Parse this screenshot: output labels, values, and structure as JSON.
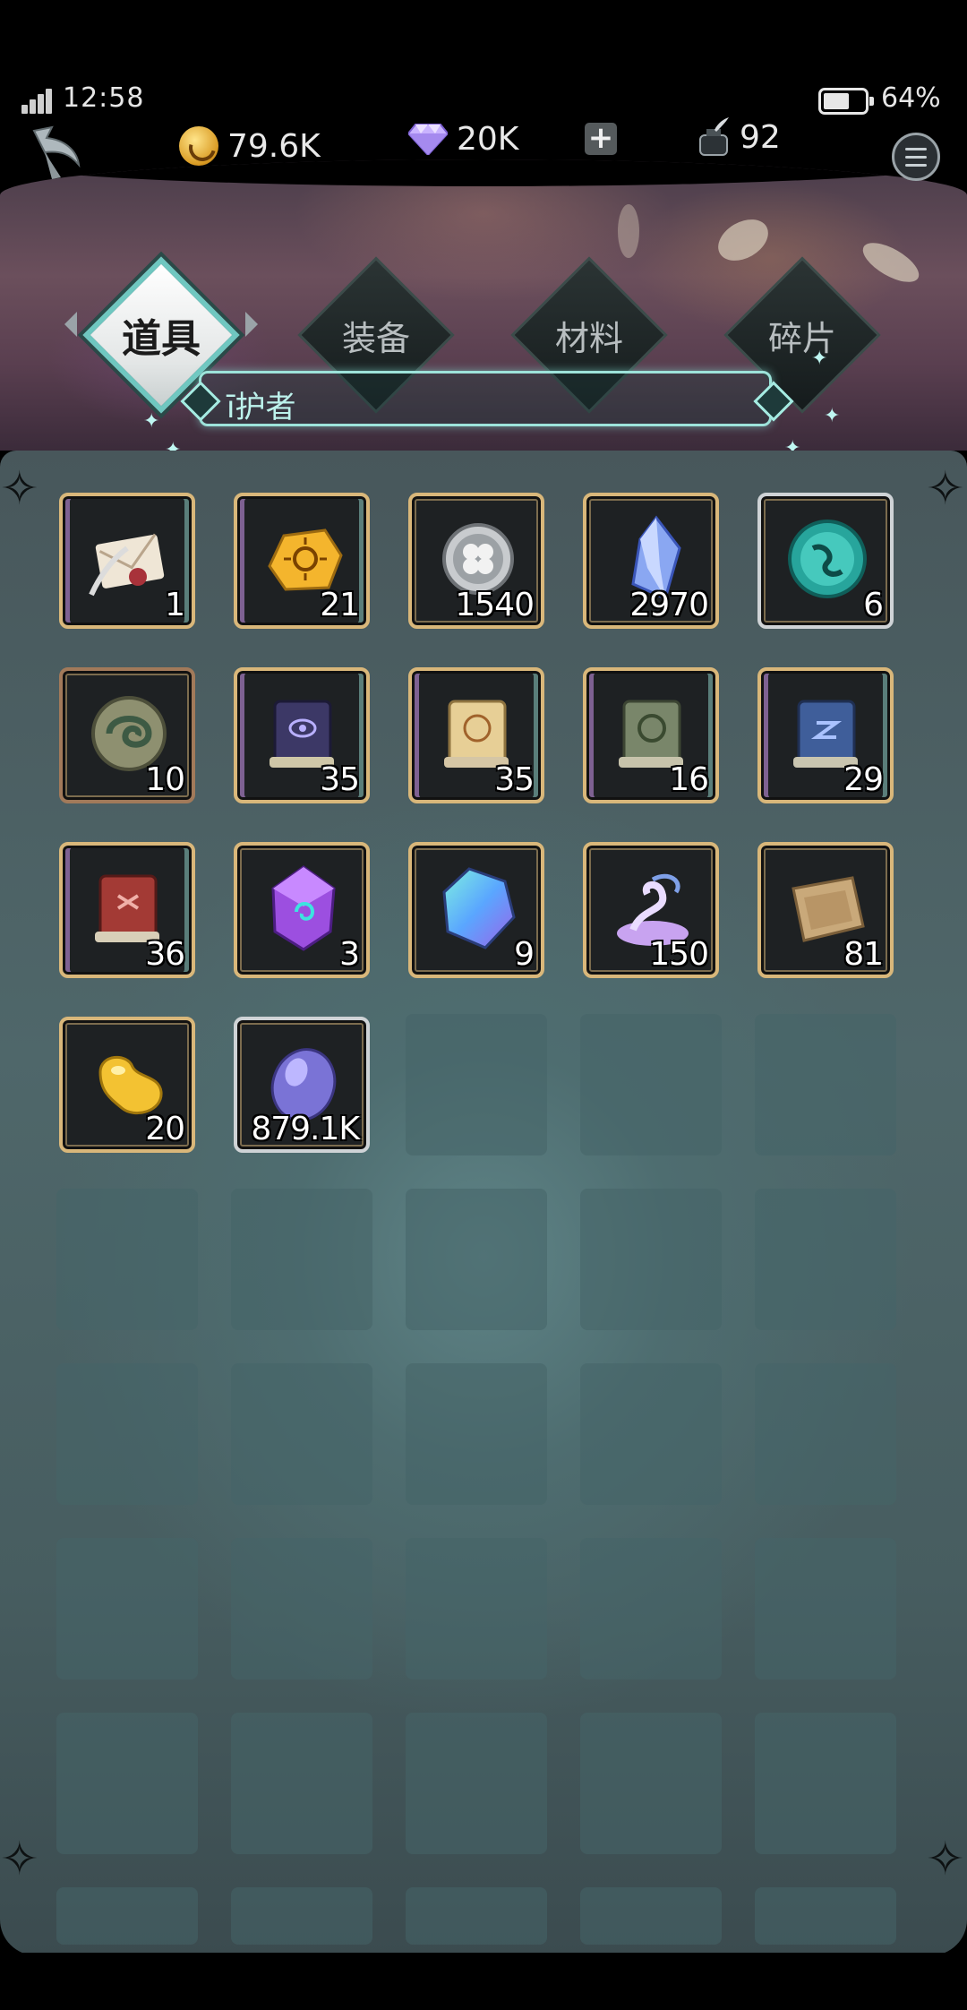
{
  "status_bar": {
    "time": "12:58",
    "battery": "64%",
    "battery_level": 0.64
  },
  "resources": {
    "gold": "79.6K",
    "diamonds": "20K",
    "ink": "92"
  },
  "tabs": [
    {
      "label": "道具",
      "active": true
    },
    {
      "label": "装备",
      "active": false
    },
    {
      "label": "材料",
      "active": false
    },
    {
      "label": "碎片",
      "active": false
    }
  ],
  "subtab": {
    "label": "ī护者"
  },
  "items": [
    {
      "name": "letter",
      "count": "1",
      "frame": "purple",
      "icon": "letter-icon"
    },
    {
      "name": "sun-stone",
      "count": "21",
      "frame": "purple",
      "icon": "sun-stone-icon"
    },
    {
      "name": "clover-coin",
      "count": "1540",
      "frame": "gold",
      "icon": "clover-coin-icon"
    },
    {
      "name": "blue-crystal",
      "count": "2970",
      "frame": "gold",
      "icon": "blue-crystal-icon"
    },
    {
      "name": "teal-orb",
      "count": "6",
      "frame": "silver",
      "icon": "teal-orb-icon"
    },
    {
      "name": "swirl-orb",
      "count": "10",
      "frame": "bronze",
      "icon": "swirl-orb-icon"
    },
    {
      "name": "dark-book",
      "count": "35",
      "frame": "purple",
      "icon": "dark-book-icon"
    },
    {
      "name": "golden-book",
      "count": "35",
      "frame": "purple",
      "icon": "golden-book-icon"
    },
    {
      "name": "green-book",
      "count": "16",
      "frame": "purple",
      "icon": "green-book-icon"
    },
    {
      "name": "blue-book",
      "count": "29",
      "frame": "purple",
      "icon": "blue-book-icon"
    },
    {
      "name": "red-book",
      "count": "36",
      "frame": "purple",
      "icon": "red-book-icon"
    },
    {
      "name": "purple-rune-gem",
      "count": "3",
      "frame": "gold",
      "icon": "purple-rune-gem-icon"
    },
    {
      "name": "rainbow-crystal",
      "count": "9",
      "frame": "gold",
      "icon": "rainbow-crystal-icon"
    },
    {
      "name": "magic-dust",
      "count": "150",
      "frame": "gold",
      "icon": "magic-dust-icon"
    },
    {
      "name": "parchment",
      "count": "81",
      "frame": "gold",
      "icon": "parchment-icon"
    },
    {
      "name": "gold-bean",
      "count": "20",
      "frame": "gold",
      "icon": "gold-bean-icon"
    },
    {
      "name": "violet-stone",
      "count": "879.1K",
      "frame": "silver",
      "icon": "violet-stone-icon"
    }
  ],
  "colors": {
    "gold_frame": "#d9b77a",
    "silver_frame": "#cfd3d6",
    "bronze_frame": "#a27a5a",
    "tab_accent": "#6fc7c0"
  }
}
